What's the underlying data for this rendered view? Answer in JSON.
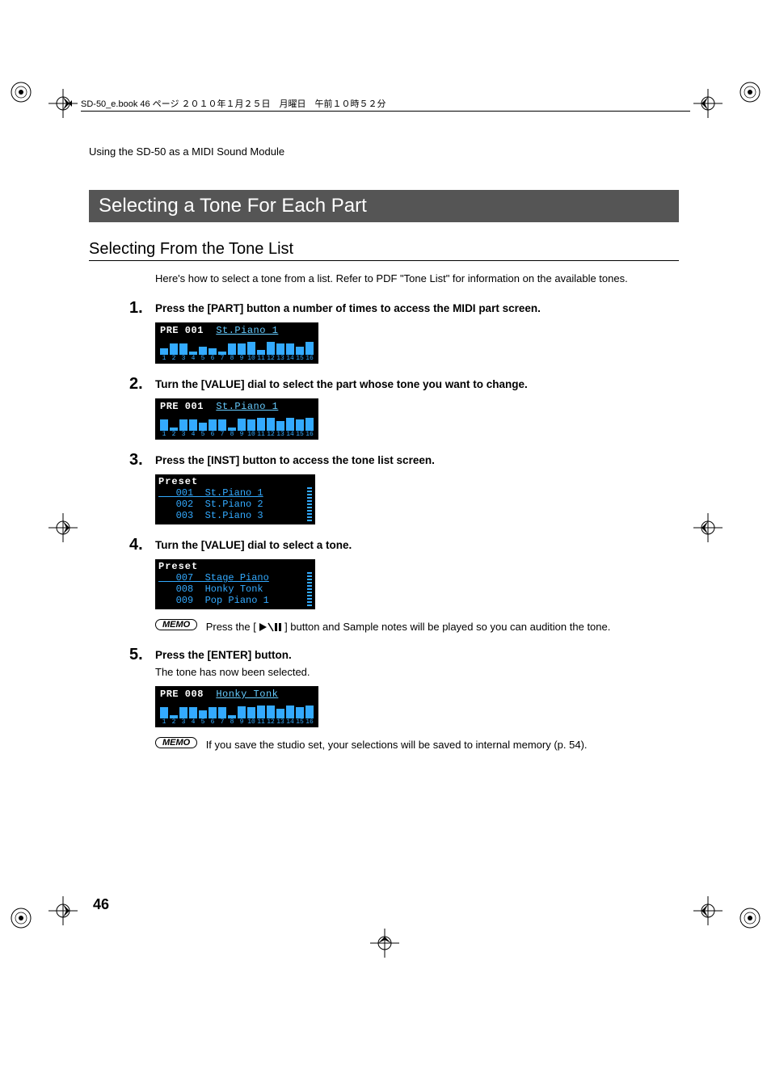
{
  "header_line": "SD-50_e.book  46 ページ  ２０１０年１月２５日　月曜日　午前１０時５２分",
  "running_head": "Using the SD-50 as a MIDI Sound Module",
  "section_title": "Selecting a Tone For Each Part",
  "subsection_title": "Selecting From the Tone List",
  "intro_text": "Here's how to select a tone from a list. Refer to PDF \"Tone List\" for information on the available tones.",
  "steps": {
    "1": {
      "num": "1.",
      "text": "Press the [PART] button a number of times to access the MIDI part screen."
    },
    "2": {
      "num": "2.",
      "text": "Turn the [VALUE] dial to select the part whose tone you want to change."
    },
    "3": {
      "num": "3.",
      "text": "Press the [INST] button to access the tone list screen."
    },
    "4": {
      "num": "4.",
      "text": "Turn the [VALUE] dial to select a tone."
    },
    "5": {
      "num": "5.",
      "text": "Press the [ENTER] button.",
      "sub": "The tone has now been selected."
    }
  },
  "lcd1": {
    "label_left": "PRE 001",
    "label_right": "St.Piano 1",
    "heights": [
      8,
      14,
      14,
      4,
      10,
      8,
      4,
      14,
      14,
      16,
      6,
      16,
      14,
      14,
      10,
      16
    ]
  },
  "lcd2": {
    "label_left": "PRE 001",
    "label_right": "St.Piano 1",
    "heights": [
      14,
      4,
      14,
      14,
      10,
      14,
      14,
      4,
      15,
      14,
      16,
      16,
      12,
      16,
      14,
      16
    ]
  },
  "lcd3": {
    "title": "Preset",
    "rows": [
      {
        "idx": "001",
        "name": "St.Piano 1",
        "sel": true
      },
      {
        "idx": "002",
        "name": "St.Piano 2",
        "sel": false
      },
      {
        "idx": "003",
        "name": "St.Piano 3",
        "sel": false
      }
    ]
  },
  "lcd4": {
    "title": "Preset",
    "rows": [
      {
        "idx": "007",
        "name": "Stage Piano",
        "sel": true
      },
      {
        "idx": "008",
        "name": "Honky Tonk",
        "sel": false
      },
      {
        "idx": "009",
        "name": "Pop Piano 1",
        "sel": false
      }
    ]
  },
  "lcd5": {
    "label_left": "PRE 008",
    "label_right": "Honky Tonk",
    "heights": [
      14,
      4,
      14,
      14,
      10,
      14,
      14,
      4,
      15,
      14,
      16,
      16,
      12,
      16,
      14,
      16
    ]
  },
  "memo_label": "MEMO",
  "memo1_before": "Press the [",
  "memo1_after": "] button and Sample notes will be played so you can audition the tone.",
  "memo2": "If you save the studio set, your selections will be saved to internal memory (p. 54).",
  "page_number": "46",
  "nums16": [
    "1",
    "2",
    "3",
    "4",
    "5",
    "6",
    "7",
    "8",
    "9",
    "10",
    "11",
    "12",
    "13",
    "14",
    "15",
    "16"
  ]
}
